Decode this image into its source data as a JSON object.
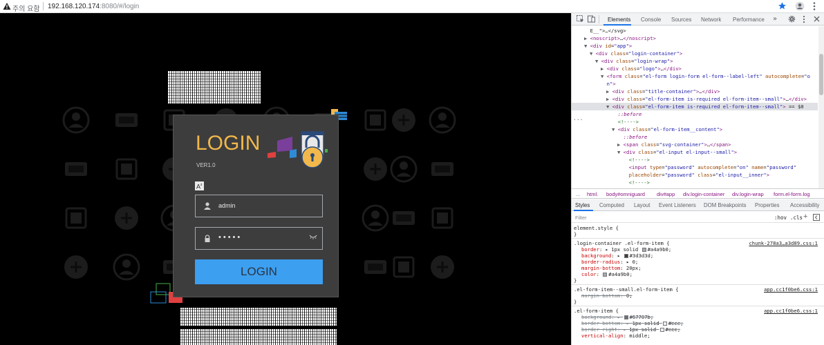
{
  "browser": {
    "warning_text": "주의 요함",
    "url_host": "192.168.120.174",
    "url_rest": ":8080/#/login",
    "colors": {
      "star": "#1a73e8"
    }
  },
  "login": {
    "title": "LOGIN",
    "version": "VER1.0",
    "username_value": "admin",
    "password_mask": "•••••",
    "button_label": "LOGIN",
    "colors": {
      "title": "#f2b84b",
      "button": "#3d9ff0",
      "card": "#3d3d3d",
      "border": "#a4a9b0"
    }
  },
  "devtools": {
    "tabs": [
      "Elements",
      "Console",
      "Sources",
      "Network",
      "Performance"
    ],
    "more": "»",
    "dom_lines": [
      {
        "indent": 0,
        "tri": "",
        "html": "<span class='txt'>E__\"&gt;…&lt;/svg&gt;</span>"
      },
      {
        "indent": 0,
        "tri": "▶",
        "html": "<span class='tag'>&lt;noscript&gt;</span>…<span class='tag'>&lt;/noscript&gt;</span>"
      },
      {
        "indent": 0,
        "tri": "▼",
        "html": "<span class='tag'>&lt;div</span> <span class='attr'>id</span>=<span class='val'>\"app\"</span><span class='tag'>&gt;</span>"
      },
      {
        "indent": 1,
        "tri": "▼",
        "html": "<span class='tag'>&lt;div</span> <span class='attr'>class</span>=<span class='val'>\"login-container\"</span><span class='tag'>&gt;</span>"
      },
      {
        "indent": 2,
        "tri": "▼",
        "html": "<span class='tag'>&lt;div</span> <span class='attr'>class</span>=<span class='val'>\"login-wrap\"</span><span class='tag'>&gt;</span>"
      },
      {
        "indent": 3,
        "tri": "▶",
        "html": "<span class='tag'>&lt;div</span> <span class='attr'>class</span>=<span class='val'>\"logo\"</span><span class='tag'>&gt;</span>…<span class='tag'>&lt;/div&gt;</span>"
      },
      {
        "indent": 3,
        "tri": "▼",
        "html": "<span class='tag'>&lt;form</span> <span class='attr'>class</span>=<span class='val'>\"el-form login-form el-form--label-left\"</span> <span class='attr'>autocomplete</span>=<span class='val'>\"o</span>"
      },
      {
        "indent": 3,
        "tri": "",
        "html": "<span class='val'>n\"</span><span class='tag'>&gt;</span>"
      },
      {
        "indent": 4,
        "tri": "▶",
        "html": "<span class='tag'>&lt;div</span> <span class='attr'>class</span>=<span class='val'>\"title-container\"</span><span class='tag'>&gt;</span>…<span class='tag'>&lt;/div&gt;</span>"
      },
      {
        "indent": 4,
        "tri": "▶",
        "html": "<span class='tag'>&lt;div</span> <span class='attr'>class</span>=<span class='val'>\"el-form-item is-required el-form-item--small\"</span><span class='tag'>&gt;</span>…<span class='tag'>&lt;/div&gt;</span>"
      },
      {
        "indent": 4,
        "tri": "▼",
        "sel": true,
        "html": "<span class='tag'>&lt;div</span> <span class='attr'>class</span>=<span class='val'>\"el-form-item is-required el-form-item--small\"</span><span class='tag'>&gt;</span> == $0"
      },
      {
        "indent": 5,
        "tri": "",
        "html": "<span class='pseudo'>::before</span>"
      },
      {
        "indent": 5,
        "tri": "",
        "html": "<span class='cmt'>&lt;!----&gt;</span>"
      },
      {
        "indent": 5,
        "tri": "▼",
        "html": "<span class='tag'>&lt;div</span> <span class='attr'>class</span>=<span class='val'>\"el-form-item__content\"</span><span class='tag'>&gt;</span>"
      },
      {
        "indent": 6,
        "tri": "",
        "html": "<span class='pseudo'>::before</span>"
      },
      {
        "indent": 6,
        "tri": "▶",
        "html": "<span class='tag'>&lt;span</span> <span class='attr'>class</span>=<span class='val'>\"svg-container\"</span><span class='tag'>&gt;</span>…<span class='tag'>&lt;/span&gt;</span>"
      },
      {
        "indent": 6,
        "tri": "▼",
        "html": "<span class='tag'>&lt;div</span> <span class='attr'>class</span>=<span class='val'>\"el-input el-input--small\"</span><span class='tag'>&gt;</span>"
      },
      {
        "indent": 7,
        "tri": "",
        "html": "<span class='cmt'>&lt;!----&gt;</span>"
      },
      {
        "indent": 7,
        "tri": "",
        "html": "<span class='tag'>&lt;input</span> <span class='attr'>type</span>=<span class='val'>\"password\"</span> <span class='attr'>autocomplete</span>=<span class='val'>\"on\"</span> <span class='attr'>name</span>=<span class='val'>\"password\"</span>"
      },
      {
        "indent": 7,
        "tri": "",
        "html": "<span class='attr'>placeholder</span>=<span class='val'>\"password\"</span> <span class='attr'>class</span>=<span class='val'>\"el-input__inner\"</span><span class='tag'>&gt;</span>"
      },
      {
        "indent": 7,
        "tri": "",
        "html": "<span class='cmt'>&lt;!----&gt;</span>"
      }
    ],
    "crumbs": [
      "...",
      "html.",
      "body#omniguard",
      "div#app",
      "div.login-container",
      "div.login-wrap",
      "form.el-form.log"
    ],
    "style_tabs": [
      "Styles",
      "Computed",
      "Layout",
      "Event Listeners",
      "DOM Breakpoints",
      "Properties",
      "Accessibility"
    ],
    "filter_placeholder": "Filter",
    "hov": ":hov",
    "cls": ".cls",
    "plus": "+",
    "rules": [
      {
        "kind": "sel",
        "text": "element.style {"
      },
      {
        "kind": "close",
        "text": "}"
      },
      {
        "kind": "sep"
      },
      {
        "kind": "sel",
        "text": ".login-container .el-form-item {",
        "src": "chunk-278a3…a3d89.css:1"
      },
      {
        "kind": "prop",
        "name": "border",
        "value": "1px solid",
        "swatch": "#a4a9b0",
        "after": "#a4a9b0;",
        "tri": true
      },
      {
        "kind": "prop",
        "name": "background",
        "value": "",
        "swatch": "#3d3d3d",
        "after": "#3d3d3d;",
        "tri": true
      },
      {
        "kind": "prop",
        "name": "border-radius",
        "value": "0;",
        "tri": true
      },
      {
        "kind": "prop",
        "name": "margin-bottom",
        "value": "20px;"
      },
      {
        "kind": "prop",
        "name": "color",
        "value": "",
        "swatch": "#a4a9b0",
        "after": "#a4a9b0;"
      },
      {
        "kind": "close",
        "text": "}"
      },
      {
        "kind": "sep"
      },
      {
        "kind": "sel",
        "text": ".el-form-item--small.el-form-item {",
        "src": "app.cc1f0be6.css:1"
      },
      {
        "kind": "prop",
        "name": "margin-bottom",
        "value": "0;",
        "strike": true
      },
      {
        "kind": "close",
        "text": "}"
      },
      {
        "kind": "sep"
      },
      {
        "kind": "sel",
        "text": ".el-form-item {",
        "src": "app.cc1f0be6.css:1"
      },
      {
        "kind": "prop",
        "name": "background",
        "value": "",
        "swatch": "#67707b",
        "after": "#67707b;",
        "strike": true,
        "tri": true
      },
      {
        "kind": "prop",
        "name": "border-bottom",
        "value": "1px solid",
        "swatch": "#eeeeee",
        "after": "#eee;",
        "strike": true,
        "tri": true
      },
      {
        "kind": "prop",
        "name": "border-right",
        "value": "1px solid",
        "swatch": "#eeeeee",
        "after": "#eee;",
        "strike": true,
        "tri": true
      },
      {
        "kind": "prop",
        "name": "vertical-align",
        "value": "middle;"
      }
    ]
  }
}
